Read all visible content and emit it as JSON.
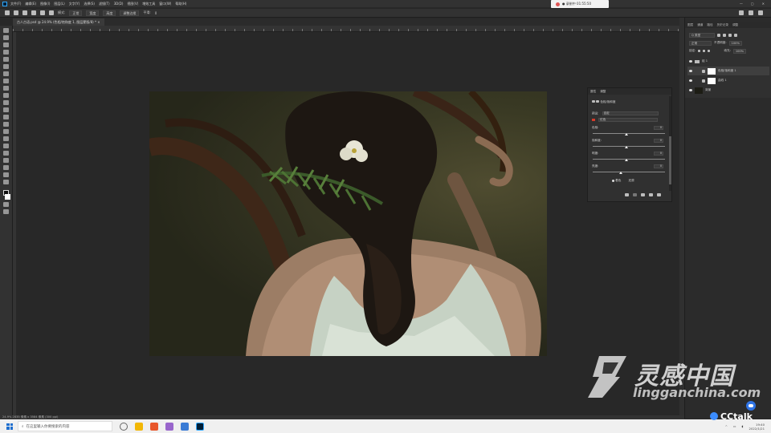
{
  "menubar": {
    "items": [
      "文件(F)",
      "编辑(E)",
      "图像(I)",
      "图层(L)",
      "文字(Y)",
      "选择(S)",
      "滤镜(T)",
      "3D(D)",
      "视图(V)",
      "增效工具",
      "窗口(W)",
      "帮助(H)"
    ]
  },
  "recording": {
    "label": "● 录制中 01:55:50"
  },
  "optionsbar": {
    "mode_label": "模式:",
    "mode_value": "正常",
    "width_label": "宽度",
    "height_label": "高度",
    "adjust_label": "调整边缘",
    "angle_label": "平滑:",
    "angle_value": "0"
  },
  "document": {
    "tab_label": "古人古语.psd @ 24.9% (色相/饱和度 1, 图层蒙版/8) * ×"
  },
  "properties": {
    "tabs": [
      "属性",
      "调整"
    ],
    "title": "色相/饱和度",
    "preset_label": "预设:",
    "preset_value": "自定",
    "channel_label": "",
    "channel_value": "红色",
    "rows": [
      {
        "label": "色相:",
        "value": "0"
      },
      {
        "label": "饱和度:",
        "value": "0"
      },
      {
        "label": "明度:",
        "value": "0"
      },
      {
        "label": "亮度:",
        "value": "0"
      }
    ],
    "colorize_label": "着色",
    "reset_label": "还原"
  },
  "layers": {
    "tabs": [
      "图层",
      "通道",
      "路径",
      "历史记录",
      "调整"
    ],
    "kind_label": "Q 类型",
    "blend_mode": "正常",
    "opacity_label": "不透明度:",
    "opacity_value": "100%",
    "lock_label": "锁定:",
    "fill_label": "填充:",
    "fill_value": "100%",
    "items": [
      {
        "name": "组 1"
      },
      {
        "name": "色相/饱和度 1"
      },
      {
        "name": "曲线 1"
      },
      {
        "name": "背景"
      }
    ]
  },
  "statusbar": {
    "text": "24.9%    2835 像素 x 3584 像素 (300 ppi)"
  },
  "taskbar": {
    "search_placeholder": "在这里输入你要搜索的内容",
    "time": "19:40",
    "date": "2022/1/21"
  },
  "watermark": {
    "cn": "灵感中国",
    "url": "lingganchina.com",
    "brand": "CCtalk"
  },
  "colors": {
    "accent_blue": "#31a8ff",
    "panel": "#303030",
    "canvas_bg": "#282828",
    "channel_swatch": "#d43b2a"
  }
}
